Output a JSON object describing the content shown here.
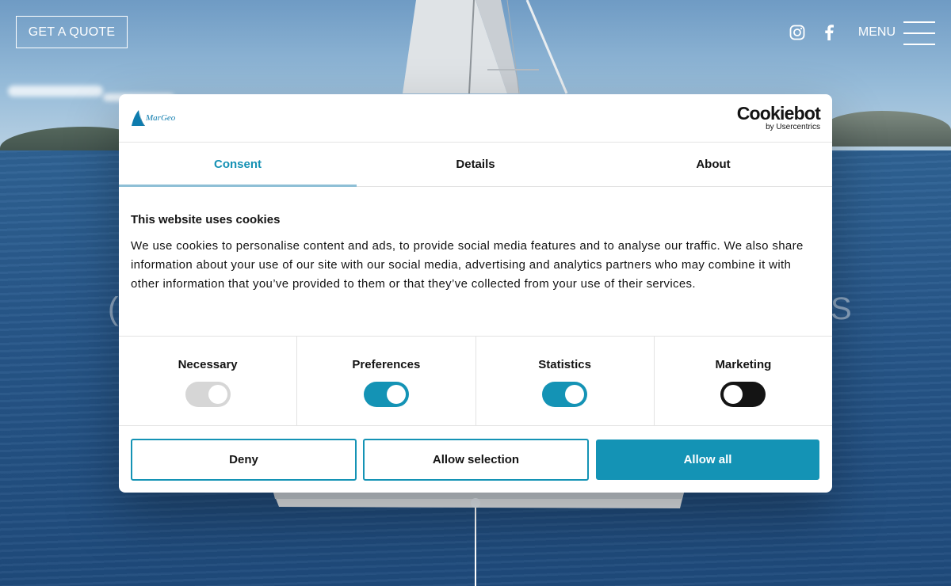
{
  "header": {
    "quote_label": "GET A QUOTE",
    "menu_label": "MENU",
    "social": [
      "instagram-icon",
      "facebook-icon"
    ]
  },
  "dialog": {
    "logo_text": "MarGeo",
    "brand_name": "Cookiebot",
    "brand_by": "by Usercentrics",
    "tabs": [
      {
        "label": "Consent",
        "active": true
      },
      {
        "label": "Details",
        "active": false
      },
      {
        "label": "About",
        "active": false
      }
    ],
    "heading": "This website uses cookies",
    "text": "We use cookies to personalise content and ads, to provide social media features and to analyse our traffic. We also share information about your use of our site with our social media, advertising and analytics partners who may combine it with other information that you’ve provided to them or that they’ve collected from your use of their services.",
    "toggles": [
      {
        "label": "Necessary",
        "checked": true,
        "disabled": true,
        "color": "#d6d6d6"
      },
      {
        "label": "Preferences",
        "checked": true,
        "disabled": false,
        "color": "#1493b5"
      },
      {
        "label": "Statistics",
        "checked": true,
        "disabled": false,
        "color": "#1493b5"
      },
      {
        "label": "Marketing",
        "checked": false,
        "disabled": false,
        "color": "#141414"
      }
    ],
    "buttons": {
      "deny": "Deny",
      "allow_selection": "Allow selection",
      "allow_all": "Allow all"
    },
    "accent_color": "#1493b5"
  }
}
